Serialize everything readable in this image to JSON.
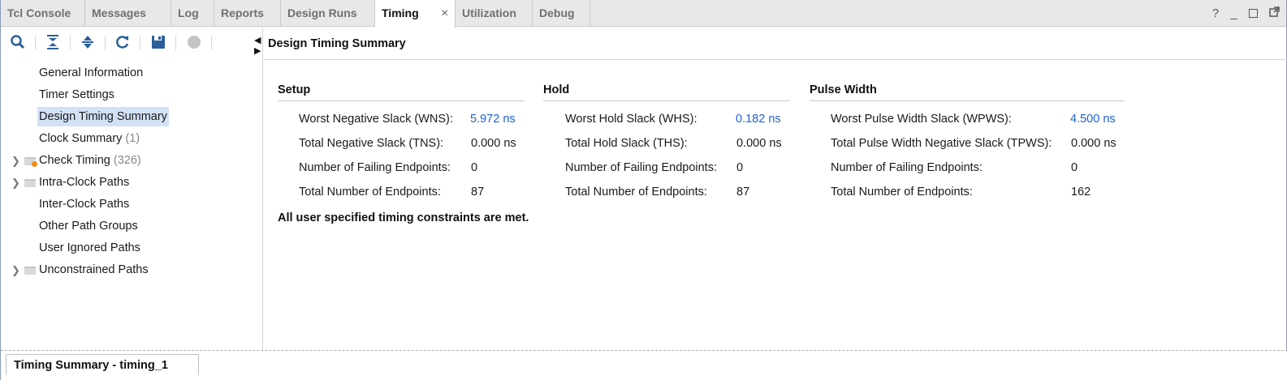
{
  "tabs": [
    {
      "label": "Tcl Console",
      "active": false
    },
    {
      "label": "Messages",
      "active": false
    },
    {
      "label": "Log",
      "active": false
    },
    {
      "label": "Reports",
      "active": false
    },
    {
      "label": "Design Runs",
      "active": false
    },
    {
      "label": "Timing",
      "active": true,
      "close": "×"
    },
    {
      "label": "Utilization",
      "active": false
    },
    {
      "label": "Debug",
      "active": false
    }
  ],
  "window_controls": {
    "help": "?",
    "minimize": "_"
  },
  "toolbar": {
    "icons": [
      "search-icon",
      "collapse-all-icon",
      "expand-all-icon",
      "refresh-icon",
      "save-icon",
      "stop-icon"
    ]
  },
  "tree": [
    {
      "label": "General Information",
      "count": ""
    },
    {
      "label": "Timer Settings",
      "count": ""
    },
    {
      "label": "Design Timing Summary",
      "count": "",
      "selected": true
    },
    {
      "label": "Clock Summary",
      "count": "(1)"
    },
    {
      "label": "Check Timing",
      "count": "(326)",
      "expandable": true,
      "folder": "warning"
    },
    {
      "label": "Intra-Clock Paths",
      "count": "",
      "expandable": true,
      "folder": "plain"
    },
    {
      "label": "Inter-Clock Paths",
      "count": ""
    },
    {
      "label": "Other Path Groups",
      "count": ""
    },
    {
      "label": "User Ignored Paths",
      "count": ""
    },
    {
      "label": "Unconstrained Paths",
      "count": "",
      "expandable": true,
      "folder": "plain"
    }
  ],
  "main": {
    "title": "Design Timing Summary",
    "setup": {
      "title": "Setup",
      "rows": [
        {
          "label": "Worst Negative Slack (WNS):",
          "value": "5.972 ns",
          "link": true
        },
        {
          "label": "Total Negative Slack (TNS):",
          "value": "0.000 ns"
        },
        {
          "label": "Number of Failing Endpoints:",
          "value": "0"
        },
        {
          "label": "Total Number of Endpoints:",
          "value": "87"
        }
      ]
    },
    "hold": {
      "title": "Hold",
      "rows": [
        {
          "label": "Worst Hold Slack (WHS):",
          "value": "0.182 ns",
          "link": true
        },
        {
          "label": "Total Hold Slack (THS):",
          "value": "0.000 ns"
        },
        {
          "label": "Number of Failing Endpoints:",
          "value": "0"
        },
        {
          "label": "Total Number of Endpoints:",
          "value": "87"
        }
      ]
    },
    "pulse": {
      "title": "Pulse Width",
      "rows": [
        {
          "label": "Worst Pulse Width Slack (WPWS):",
          "value": "4.500 ns",
          "link": true
        },
        {
          "label": "Total Pulse Width Negative Slack (TPWS):",
          "value": "0.000 ns"
        },
        {
          "label": "Number of Failing Endpoints:",
          "value": "0"
        },
        {
          "label": "Total Number of Endpoints:",
          "value": "162"
        }
      ]
    },
    "status": "All user specified timing constraints are met."
  },
  "bottom_tab": {
    "label": "Timing Summary - timing_1"
  },
  "colors": {
    "link": "#1f62d6",
    "selection": "#d3e1f6",
    "icon": "#2b5f9b"
  }
}
